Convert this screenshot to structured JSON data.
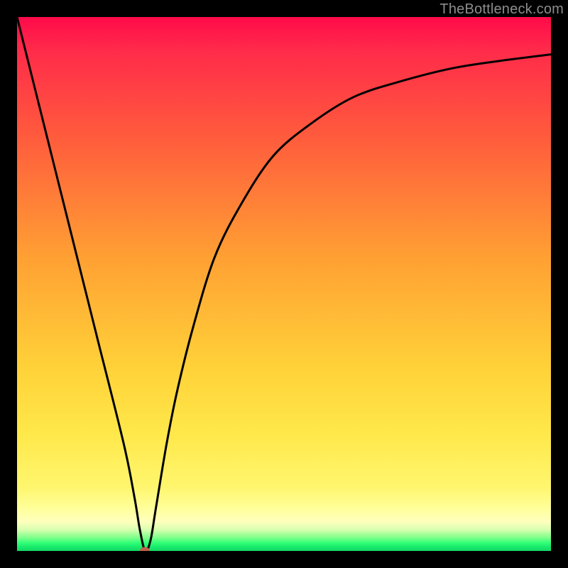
{
  "attribution": "TheBottleneck.com",
  "chart_data": {
    "type": "line",
    "title": "",
    "xlabel": "",
    "ylabel": "",
    "xlim": [
      0,
      100
    ],
    "ylim": [
      0,
      100
    ],
    "grid": false,
    "series": [
      {
        "name": "bottleneck-curve",
        "x": [
          0,
          5,
          10,
          15,
          20,
          22,
          23,
          24,
          25,
          26,
          28,
          30,
          33,
          37,
          42,
          48,
          55,
          63,
          72,
          82,
          92,
          100
        ],
        "y": [
          100,
          80,
          60,
          40,
          20,
          10,
          4,
          0,
          2,
          8,
          20,
          30,
          42,
          55,
          65,
          74,
          80,
          85,
          88,
          90.5,
          92,
          93
        ]
      }
    ],
    "marker": {
      "name": "optimum-point",
      "x": 24,
      "y": 0,
      "color": "#c1604a"
    },
    "gradient_stops": [
      {
        "pos": 0.0,
        "color": "#ff0a4a"
      },
      {
        "pos": 0.45,
        "color": "#ffa033"
      },
      {
        "pos": 0.88,
        "color": "#fff66e"
      },
      {
        "pos": 0.97,
        "color": "#7fff8a"
      },
      {
        "pos": 1.0,
        "color": "#13d865"
      }
    ]
  }
}
